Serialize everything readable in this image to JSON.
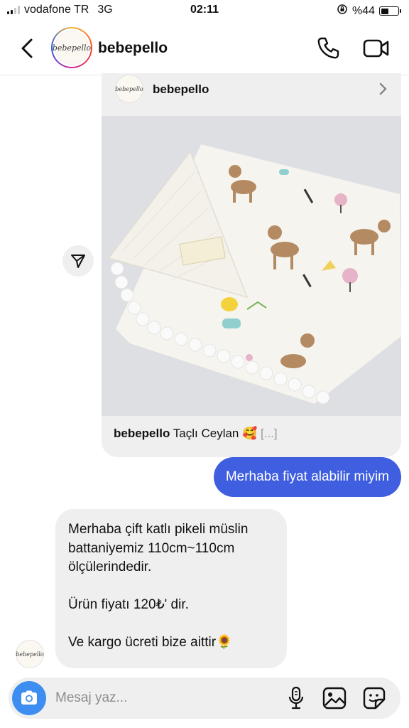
{
  "status_bar": {
    "carrier": "vodafone TR",
    "network": "3G",
    "time": "02:11",
    "battery": "%44",
    "battery_level": 0.44,
    "signal_bars_active": 2
  },
  "header": {
    "username": "bebepello",
    "avatar_text": "bebepello",
    "icons": [
      "chevron-left-icon",
      "phone-icon",
      "video-camera-icon"
    ]
  },
  "shared_post": {
    "username": "bebepello",
    "avatar_text": "bebepello",
    "caption_user": "bebepello",
    "caption_text": "Taçlı Ceylan 🥰",
    "caption_more": "[...]"
  },
  "messages": {
    "outgoing": "Merhaba fiyat alabilir miyim",
    "incoming": {
      "line1": "Merhaba çift katlı pikeli müslin",
      "line2": "battaniyemiz 110cm~110cm",
      "line3": "ölçülerindedir.",
      "line4": "Ürün fiyatı 120₺' dir.",
      "line5": "Ve kargo ücreti bize aittir🌻"
    },
    "incoming_avatar_text": "bebepello"
  },
  "composer": {
    "placeholder": "Mesaj yaz..."
  },
  "colors": {
    "accent_blue": "#3f5ee0",
    "camera_blue": "#3d8ef0",
    "bubble_gray": "#efefef"
  }
}
